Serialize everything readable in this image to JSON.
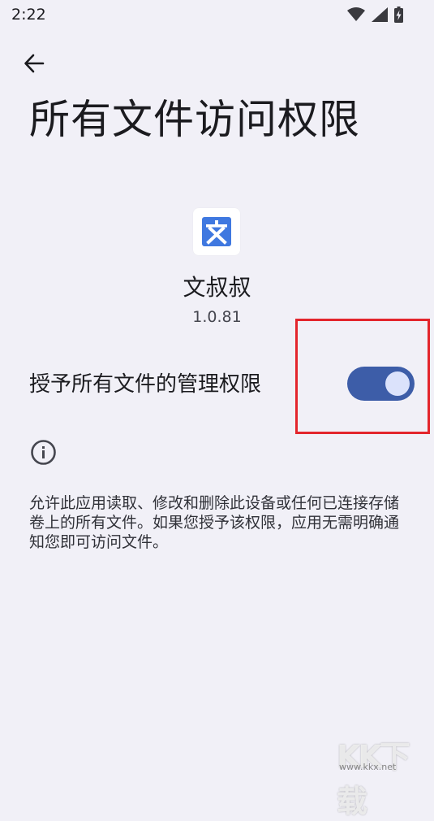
{
  "status_bar": {
    "time": "2:22",
    "icons": [
      "wifi-icon",
      "signal-icon",
      "battery-charging-icon"
    ]
  },
  "header": {
    "back_icon": "arrow-left-icon",
    "title": "所有文件访问权限"
  },
  "app": {
    "icon_glyph": "文",
    "icon_color": "#3f78e0",
    "name": "文叔叔",
    "version": "1.0.81"
  },
  "permission": {
    "label": "授予所有文件的管理权限",
    "enabled": true,
    "toggle_color": "#3d5da8",
    "highlight_color": "#e3252c"
  },
  "info": {
    "icon": "info-icon",
    "description": "允许此应用读取、修改和删除此设备或任何已连接存储卷上的所有文件。如果您授予该权限，应用无需明确通知您即可访问文件。"
  },
  "watermark": {
    "logo": "KK下载",
    "url": "www.kkx.net"
  }
}
